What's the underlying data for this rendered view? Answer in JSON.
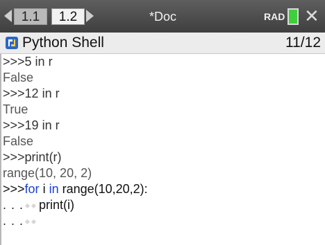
{
  "tabs": [
    {
      "label": "1.1",
      "active": false
    },
    {
      "label": "1.2",
      "active": true
    }
  ],
  "document": {
    "title": "*Doc"
  },
  "status": {
    "angle_mode": "RAD",
    "battery_level": 1.0
  },
  "app": {
    "title": "Python Shell",
    "page_counter": "11/12"
  },
  "console": {
    "lines": [
      {
        "kind": "input",
        "prompt": ">>>",
        "text": "5 in r"
      },
      {
        "kind": "output",
        "text": "False"
      },
      {
        "kind": "input",
        "prompt": ">>>",
        "text": "12 in r"
      },
      {
        "kind": "output",
        "text": "True"
      },
      {
        "kind": "input",
        "prompt": ">>>",
        "text": "19 in r"
      },
      {
        "kind": "output",
        "text": "False"
      },
      {
        "kind": "input",
        "prompt": ">>>",
        "text": "print(r)"
      },
      {
        "kind": "output",
        "text": "range(10, 20, 2)"
      },
      {
        "kind": "input",
        "prompt": ">>>",
        "kw1": "for",
        "mid": " i ",
        "kw2": "in",
        "rest": " range(10,20,2):"
      },
      {
        "kind": "continuation",
        "prompt": ". . .",
        "text": "print(i)"
      },
      {
        "kind": "continuation",
        "prompt": ". . .",
        "text": ""
      }
    ]
  },
  "colors": {
    "keyword": "#1a3fd6",
    "battery": "#3fcf3a",
    "header_bar": "#4a4a4a"
  }
}
